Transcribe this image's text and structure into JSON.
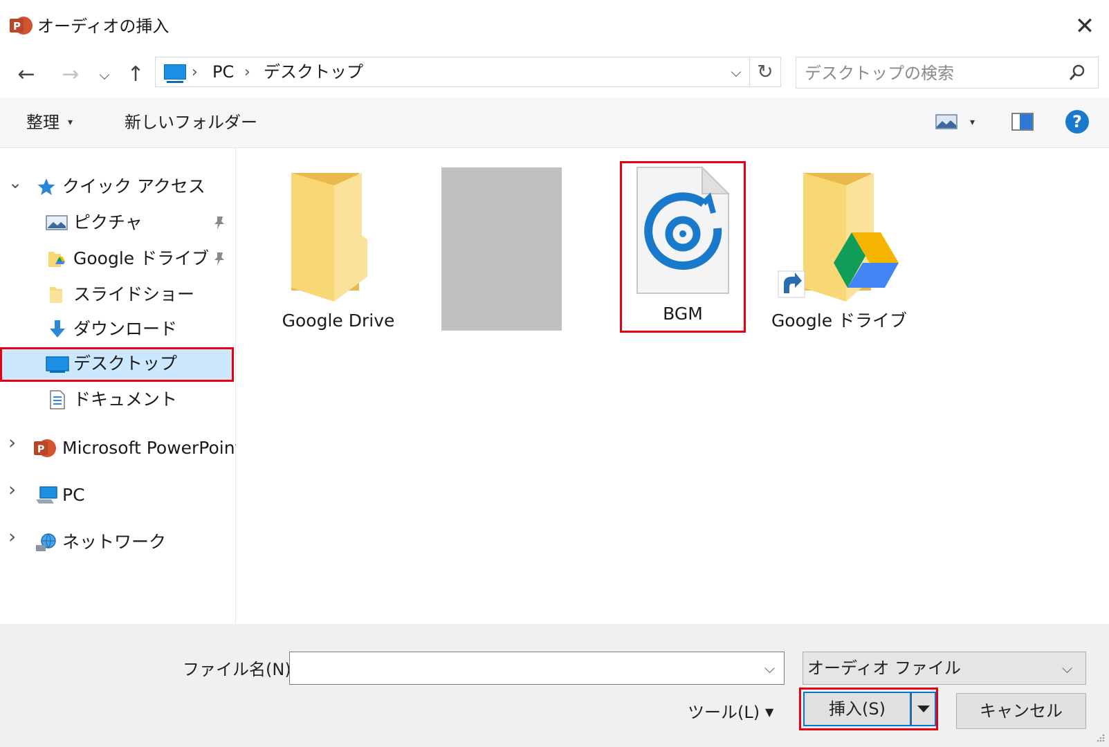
{
  "window": {
    "title": "オーディオの挿入",
    "close_glyph": "✕"
  },
  "nav": {
    "back_glyph": "←",
    "forward_glyph": "→",
    "recent_glyph": "⌵",
    "up_glyph": "↑"
  },
  "address": {
    "crumbs": [
      "PC",
      "デスクトップ"
    ],
    "sep_glyph": "›",
    "dropdown_glyph": "⌵",
    "refresh_glyph": "↻"
  },
  "search": {
    "placeholder": "デスクトップの検索"
  },
  "toolbar": {
    "organize_label": "整理",
    "caret_glyph": "▾",
    "new_folder_label": "新しいフォルダー",
    "help_glyph": "?"
  },
  "sidebar": {
    "expand_glyph": "⌄",
    "collapsed_glyph": "›",
    "quick_access": "クイック アクセス",
    "items": [
      {
        "label": "ピクチャ"
      },
      {
        "label": "Google ドライブ"
      },
      {
        "label": "スライドショー"
      },
      {
        "label": "ダウンロード"
      },
      {
        "label": "デスクトップ"
      },
      {
        "label": "ドキュメント"
      }
    ],
    "powerpoint": "Microsoft PowerPoint",
    "pc": "PC",
    "network": "ネットワーク"
  },
  "files": [
    {
      "name": "Google Drive"
    },
    {
      "name": ""
    },
    {
      "name": "BGM"
    },
    {
      "name": "Google ドライブ"
    }
  ],
  "bottom": {
    "file_name_label": "ファイル名(N):",
    "file_name_value": "",
    "dropdown_glyph": "⌵",
    "file_type": "オーディオ ファイル",
    "tools_label": "ツール(L)",
    "tools_caret": "▼",
    "insert_label": "挿入(S)",
    "cancel_label": "キャンセル"
  },
  "colors": {
    "accent": "#0078d7",
    "selection": "#cce8ff",
    "highlight_box": "#e60012",
    "folder": "#f8d775"
  }
}
